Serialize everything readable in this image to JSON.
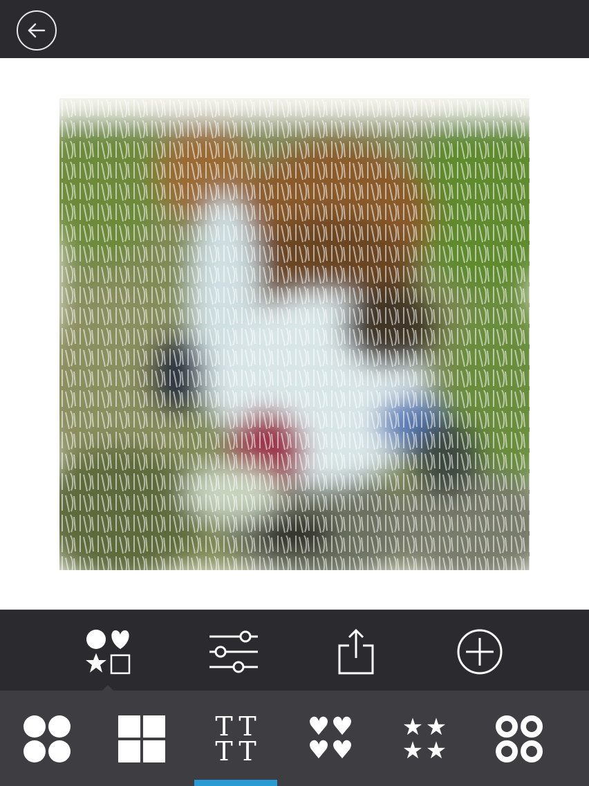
{
  "top_bar": {
    "back_icon": "arrow-left-circle-icon"
  },
  "canvas": {
    "description_icon": "typographic-portrait-artwork"
  },
  "toolbar": {
    "items": [
      {
        "id": "shapes",
        "icon": "shapes-icon",
        "selected": true
      },
      {
        "id": "adjust",
        "icon": "sliders-icon",
        "selected": false
      },
      {
        "id": "share",
        "icon": "share-icon",
        "selected": false
      },
      {
        "id": "add",
        "icon": "plus-circle-icon",
        "selected": false
      }
    ]
  },
  "shape_bar": {
    "items": [
      {
        "id": "circles",
        "icon": "four-circles-icon"
      },
      {
        "id": "squares",
        "icon": "four-squares-icon"
      },
      {
        "id": "text",
        "icon": "text-tiles-icon",
        "glyph": "T",
        "selected": true
      },
      {
        "id": "hearts",
        "icon": "four-hearts-icon",
        "glyph": "♥"
      },
      {
        "id": "stars",
        "icon": "four-stars-icon",
        "glyph": "★"
      },
      {
        "id": "rings",
        "icon": "four-rings-icon"
      }
    ],
    "tt": [
      "T",
      "T",
      "T",
      "T"
    ],
    "hearts": [
      "♥",
      "♥",
      "♥",
      "♥"
    ],
    "stars": [
      "★",
      "★",
      "★",
      "★"
    ]
  },
  "colors": {
    "bar_dark": "#2b2a2e",
    "bar_mid": "#3e3d42",
    "accent": "#2a9ad5"
  }
}
